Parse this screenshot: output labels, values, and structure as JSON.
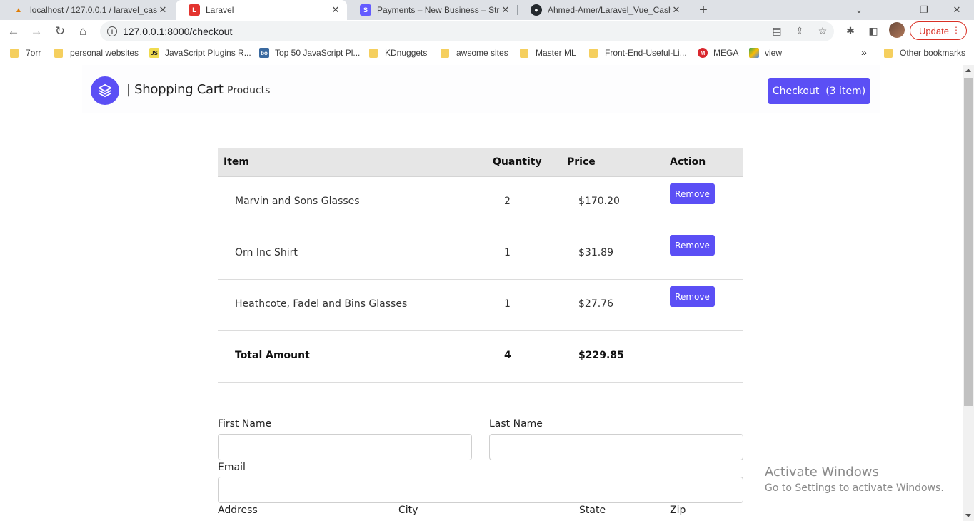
{
  "browser": {
    "tabs": [
      {
        "title": "localhost / 127.0.0.1 / laravel_cas",
        "icon": "phpmyadmin-icon"
      },
      {
        "title": "Laravel",
        "icon": "laravel-icon"
      },
      {
        "title": "Payments – New Business – Strip",
        "icon": "stripe-icon"
      },
      {
        "title": "Ahmed-Amer/Laravel_Vue_Cashi",
        "icon": "github-icon"
      }
    ],
    "url": "127.0.0.1:8000/checkout",
    "update_label": "Update",
    "bookmarks": [
      "7orr",
      "personal websites",
      "JavaScript Plugins R...",
      "Top 50 JavaScript Pl...",
      "KDnuggets",
      "awsome sites",
      "Master ML",
      "Front-End-Useful-Li...",
      "MEGA",
      "view"
    ],
    "other_bookmarks": "Other bookmarks",
    "overflow": "»"
  },
  "header": {
    "brand": "| Shopping Cart",
    "nav_products": "Products",
    "checkout_label": "Checkout  (3 item)"
  },
  "cart": {
    "columns": {
      "item": "Item",
      "quantity": "Quantity",
      "price": "Price",
      "action": "Action"
    },
    "rows": [
      {
        "item": "Marvin and Sons Glasses",
        "quantity": "2",
        "price": "$170.20",
        "action": "Remove"
      },
      {
        "item": "Orn Inc Shirt",
        "quantity": "1",
        "price": "$31.89",
        "action": "Remove"
      },
      {
        "item": "Heathcote, Fadel and Bins Glasses",
        "quantity": "1",
        "price": "$27.76",
        "action": "Remove"
      }
    ],
    "total": {
      "label": "Total Amount",
      "quantity": "4",
      "price": "$229.85"
    }
  },
  "form": {
    "first_name": "First Name",
    "last_name": "Last Name",
    "email": "Email",
    "address": "Address",
    "city": "City",
    "state": "State",
    "zip": "Zip"
  },
  "watermark": {
    "line1": "Activate Windows",
    "line2": "Go to Settings to activate Windows."
  },
  "colors": {
    "accent": "#5b4ff5",
    "table_header": "#e6e6e6"
  }
}
